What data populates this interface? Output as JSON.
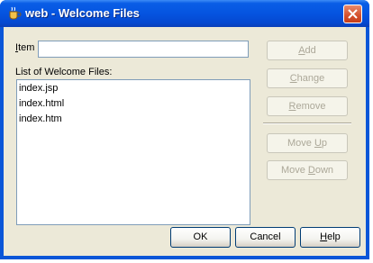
{
  "window": {
    "title": "web - Welcome Files"
  },
  "item": {
    "label_char": "I",
    "label_rest": "tem :",
    "value": ""
  },
  "list": {
    "label": "List of Welcome Files:",
    "items": [
      "index.jsp",
      "index.html",
      "index.htm"
    ]
  },
  "side_buttons": {
    "add": {
      "mnemonic": "A",
      "rest": "dd",
      "enabled": false
    },
    "change": {
      "mnemonic": "C",
      "rest": "hange",
      "enabled": false
    },
    "remove": {
      "pre": "",
      "mnemonic": "R",
      "rest": "emove",
      "enabled": false
    },
    "move_up": {
      "pre": "Move ",
      "mnemonic": "U",
      "rest": "p",
      "enabled": false
    },
    "move_down": {
      "pre": "Move ",
      "mnemonic": "D",
      "rest": "own",
      "enabled": false
    }
  },
  "footer_buttons": {
    "ok": "OK",
    "cancel": "Cancel",
    "help_mnemonic": "H",
    "help_rest": "elp"
  },
  "colors": {
    "title_bar": "#0554e0",
    "client_bg": "#ece9d8",
    "close_button": "#d4502d"
  },
  "icons": {
    "app": "netbeans-cup-icon",
    "close": "close-icon"
  }
}
